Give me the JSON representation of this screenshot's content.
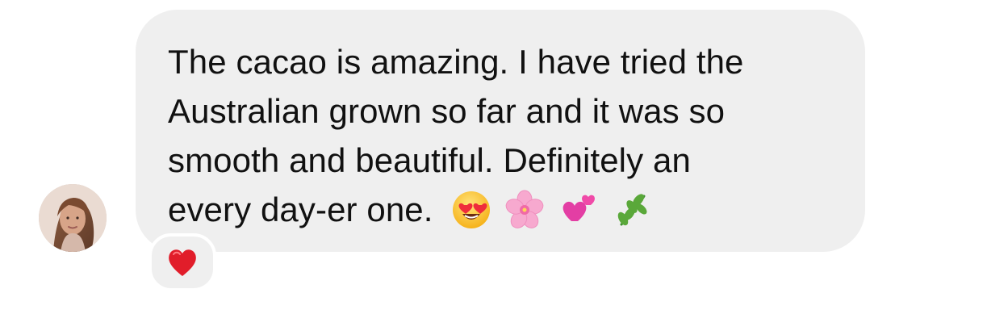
{
  "message": {
    "lines": [
      "The cacao is amazing. I have tried the",
      "Australian grown so far and it was so",
      "smooth and beautiful. Definitely an",
      "every day-er one."
    ],
    "emojis": [
      "smiling-face-with-heart-eyes-icon",
      "cherry-blossom-icon",
      "two-hearts-icon",
      "herb-icon"
    ]
  },
  "reaction": {
    "emoji": "red-heart-icon"
  },
  "colors": {
    "bubble_background": "#efefef",
    "text": "#111111",
    "reaction_heart": "#e11d2a"
  }
}
